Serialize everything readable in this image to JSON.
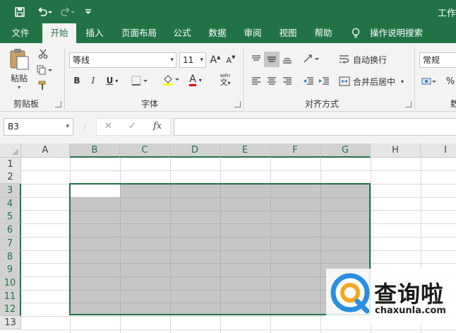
{
  "window": {
    "title": "工作"
  },
  "ribbon_tabs": [
    "文件",
    "开始",
    "插入",
    "页面布局",
    "公式",
    "数据",
    "审阅",
    "视图",
    "帮助"
  ],
  "active_tab": "开始",
  "tell_me": "操作说明搜索",
  "clipboard": {
    "paste_label": "粘贴",
    "group_label": "剪贴板"
  },
  "font": {
    "name": "等线",
    "size": "11",
    "bold": "B",
    "italic": "I",
    "underline": "U",
    "grow": "A",
    "shrink": "A",
    "color_letter": "A",
    "fill_letter": "A",
    "phonetic": "wén",
    "group_label": "字体"
  },
  "alignment": {
    "wrap_text": "自动换行",
    "merge_center": "合并后居中",
    "group_label": "对齐方式"
  },
  "number": {
    "format": "常规",
    "percent": "%",
    "group_label_partial": "数"
  },
  "formula_bar": {
    "name_box": "B3",
    "fx": "fx",
    "cancel": "✕",
    "enter": "✓"
  },
  "columns": [
    "A",
    "B",
    "C",
    "D",
    "E",
    "F",
    "G",
    "H",
    "I"
  ],
  "rows": [
    "1",
    "2",
    "3",
    "4",
    "5",
    "6",
    "7",
    "8",
    "9",
    "10",
    "11",
    "12",
    "13"
  ],
  "selected_range": "B3:G12",
  "watermark": {
    "brand": "查询啦",
    "url": "chaxunla.com"
  },
  "colors": {
    "accent": "#217346",
    "selection_fill": "#c6c6c6"
  }
}
